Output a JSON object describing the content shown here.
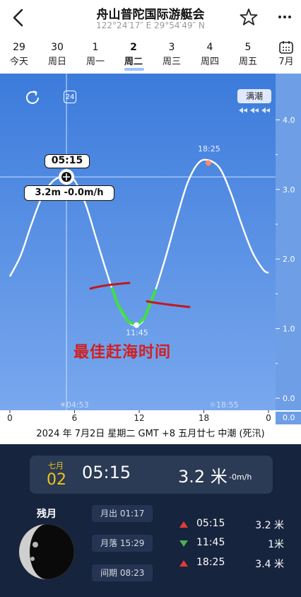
{
  "header": {
    "title": "舟山普陀国际游艇会",
    "coordinates": "122°24′17″ E 29°54′49″ N"
  },
  "dates": [
    {
      "num": "29",
      "day": "今天"
    },
    {
      "num": "30",
      "day": "周日"
    },
    {
      "num": "1",
      "day": "周一"
    },
    {
      "num": "2",
      "day": "周二",
      "active": true
    },
    {
      "num": "3",
      "day": "周三"
    },
    {
      "num": "4",
      "day": "周四"
    },
    {
      "num": "5",
      "day": "周五"
    },
    {
      "num": "",
      "day": "7月",
      "icon": "calendar-icon"
    }
  ],
  "chart_data": {
    "type": "line",
    "x_ticks": [
      "0",
      "6",
      "12",
      "18",
      "0"
    ],
    "y_ticks": [
      "4.0",
      "3.0",
      "2.0",
      "1.0",
      "0.0"
    ],
    "y_bottom_label": "0.0",
    "ylim": [
      0,
      4.4
    ],
    "xlim": [
      0,
      24
    ],
    "series": [
      {
        "x": [
          0,
          1,
          2,
          3,
          4,
          5,
          5.25,
          6,
          7,
          8,
          9,
          10,
          11,
          11.75,
          12.5,
          13.5,
          14.5,
          15.5,
          16.5,
          17.5,
          18.42,
          19.5,
          20.5,
          21.5,
          22.5,
          23.5,
          24
        ],
        "values": [
          1.75,
          2.05,
          2.5,
          2.9,
          3.12,
          3.2,
          3.2,
          3.13,
          2.8,
          2.3,
          1.8,
          1.35,
          1.1,
          1.05,
          1.15,
          1.55,
          2.05,
          2.6,
          3.1,
          3.38,
          3.42,
          3.3,
          2.95,
          2.5,
          2.1,
          1.85,
          1.8
        ]
      }
    ],
    "markers": [
      {
        "time": "18:25",
        "height": 3.4,
        "kind": "high"
      },
      {
        "time": "11:45",
        "height": 1.05,
        "kind": "low"
      }
    ],
    "best_window": [
      9.5,
      13.5
    ],
    "grid": false,
    "legend": "none"
  },
  "chart_overlay": {
    "tide_state": "满潮",
    "refresh_icon": "refresh-icon",
    "hours_toggle": "24",
    "cursor_time": "05:15",
    "cursor_value": "3.2m -0.0m/h",
    "high_label": "18:25",
    "low_label": "11:45",
    "best_time_label": "最佳赶海时间",
    "sunrise": "04:53",
    "sunset": "18:55"
  },
  "info_line": "2024 年 7月2日 星期二 GMT +8 五月廿七 中潮 (死汛)",
  "now_card": {
    "month": "七月",
    "day": "02",
    "time": "05:15",
    "height": "3.2 米",
    "speed": "-0m/h"
  },
  "moon": {
    "phase": "残月",
    "rise_label": "月出",
    "rise": "01:17",
    "set_label": "月落",
    "set": "15:29",
    "interval_label": "间期",
    "interval": "08:23"
  },
  "tide_table": [
    {
      "time": "05:15",
      "height": "3.2 米",
      "kind": "high"
    },
    {
      "time": "11:45",
      "height": "1米",
      "kind": "low"
    },
    {
      "time": "18:25",
      "height": "3.4 米",
      "kind": "high"
    }
  ],
  "colors": {
    "chart_bg_top": "#3c7bdb",
    "chart_bg_bottom": "#79a8ee",
    "curve": "#ffffff",
    "best_window": "#3fe03f",
    "panel_bg": "#16243e",
    "accent_gold": "#f0c419",
    "high_marker": "#e53935",
    "low_marker": "#4caf50"
  }
}
